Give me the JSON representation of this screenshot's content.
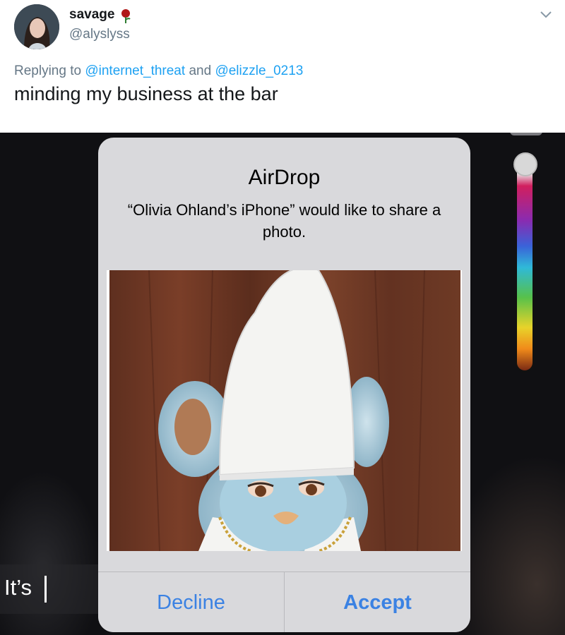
{
  "tweet": {
    "display_name": "savage",
    "name_emoji": "rose-icon",
    "handle": "@alyslyss",
    "reply_prefix": "Replying to ",
    "reply_user_1": "@internet_threat",
    "reply_joiner": " and ",
    "reply_user_2": "@elizzle_0213",
    "text": "minding my business at the bar"
  },
  "airdrop": {
    "title": "AirDrop",
    "message": "“Olivia Ohland’s iPhone” would like to share a photo.",
    "decline_label": "Decline",
    "accept_label": "Accept",
    "photo_subject": "furby-pope-photo"
  },
  "editor": {
    "caption_text": "It’s",
    "slider_icon": "color-slider"
  },
  "colors": {
    "link": "#1da1f2",
    "ios_blue": "#3b82e3",
    "dialog_bg": "#d9d9dc"
  }
}
